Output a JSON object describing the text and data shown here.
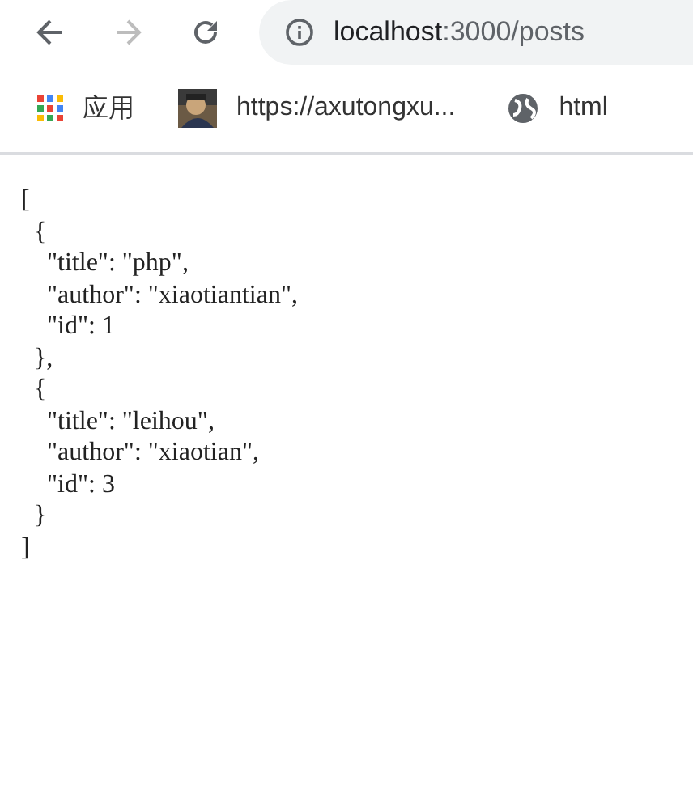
{
  "toolbar": {
    "address_host": "localhost",
    "address_path": ":3000/posts"
  },
  "bookmarks": [
    {
      "kind": "apps",
      "label": "应用"
    },
    {
      "kind": "avatar",
      "label": "https://axutongxu..."
    },
    {
      "kind": "globe",
      "label": "html"
    }
  ],
  "json_lines": [
    "[",
    "  {",
    "    \"title\": \"php\",",
    "    \"author\": \"xiaotiantian\",",
    "    \"id\": 1",
    "  },",
    "  {",
    "    \"title\": \"leihou\",",
    "    \"author\": \"xiaotian\",",
    "    \"id\": 3",
    "  }",
    "]"
  ]
}
